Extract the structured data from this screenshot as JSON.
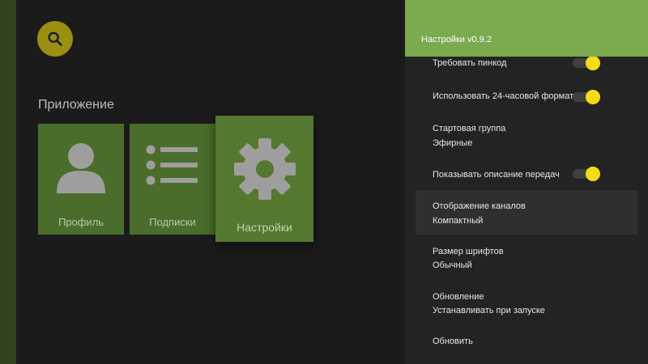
{
  "app": {
    "section_title": "Приложение",
    "cards": [
      {
        "label": "Профиль",
        "icon": "person-icon"
      },
      {
        "label": "Подписки",
        "icon": "list-icon"
      },
      {
        "label": "Настройки",
        "icon": "gear-icon"
      }
    ],
    "search_icon": "search-icon"
  },
  "settings": {
    "title": "Настройки v0.9.2",
    "items": [
      {
        "title": "Требовать пинкод",
        "toggle": true
      },
      {
        "title": "Использовать 24-часовой формат",
        "toggle": true
      },
      {
        "title": "Стартовая группа",
        "value": "Эфирные"
      },
      {
        "title": "Показывать описание передач",
        "toggle": true
      },
      {
        "title": "Отображение каналов",
        "value": "Компактный"
      },
      {
        "title": "Размер шрифтов",
        "value": "Обычный"
      },
      {
        "title": "Обновление",
        "value": "Устанавливать при запуске"
      },
      {
        "title": "Обновить"
      }
    ]
  },
  "colors": {
    "accent_green": "#7caa4e",
    "card_green": "#4a6d2c",
    "toggle_yellow": "#f2de11",
    "search_yellow": "#9a8f10"
  }
}
